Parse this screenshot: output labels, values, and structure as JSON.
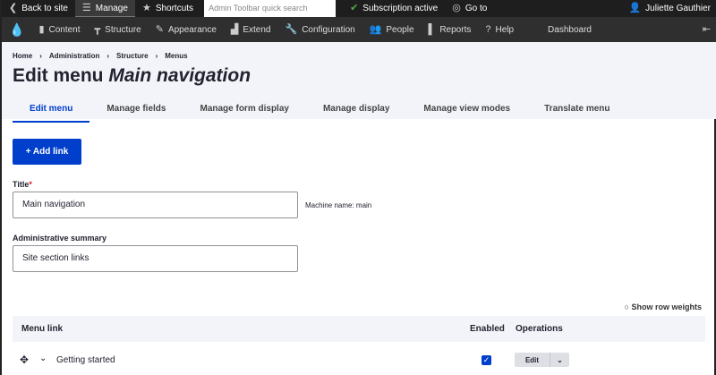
{
  "toolbar": {
    "back": "Back to site",
    "manage": "Manage",
    "shortcuts": "Shortcuts",
    "search_placeholder": "Admin Toolbar quick search",
    "subscription": "Subscription active",
    "goto": "Go to",
    "user": "Juliette Gauthier"
  },
  "admin_menu": [
    "Content",
    "Structure",
    "Appearance",
    "Extend",
    "Configuration",
    "People",
    "Reports",
    "Help",
    "Dashboard"
  ],
  "breadcrumb": [
    "Home",
    "Administration",
    "Structure",
    "Menus"
  ],
  "title": {
    "prefix": "Edit menu",
    "name": "Main navigation"
  },
  "tabs": [
    "Edit menu",
    "Manage fields",
    "Manage form display",
    "Manage display",
    "Manage view modes",
    "Translate menu"
  ],
  "add_link": "+ Add link",
  "form": {
    "title_label": "Title",
    "title_value": "Main navigation",
    "machine_name": "Machine name: main",
    "summary_label": "Administrative summary",
    "summary_value": "Site section links"
  },
  "table": {
    "show_weights": "Show row weights",
    "headers": [
      "Menu link",
      "Enabled",
      "Operations"
    ],
    "rows": [
      {
        "label": "Getting started",
        "enabled": true,
        "op": "Edit"
      }
    ]
  },
  "colors": {
    "accent": "#003ecc"
  }
}
